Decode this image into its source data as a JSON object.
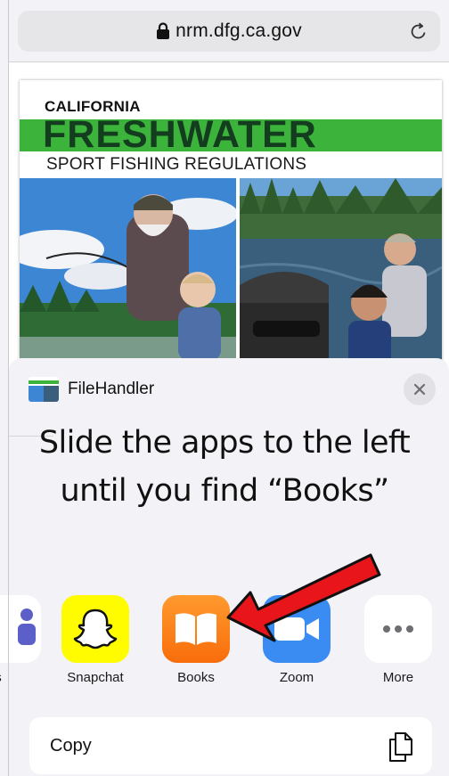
{
  "browser": {
    "url": "nrm.dfg.ca.gov",
    "lock_icon": "lock-icon",
    "reload_icon": "reload-icon"
  },
  "document": {
    "kicker": "CALIFORNIA",
    "title": "FRESHWATER",
    "subtitle": "SPORT FISHING REGULATIONS",
    "accent_color": "#3cb43c"
  },
  "share_sheet": {
    "file_name": "FileHandler",
    "close_icon": "close-icon",
    "apps": [
      {
        "label": "s",
        "icon": "teams-icon"
      },
      {
        "label": "Snapchat",
        "icon": "snapchat-icon"
      },
      {
        "label": "Books",
        "icon": "books-icon"
      },
      {
        "label": "Zoom",
        "icon": "zoom-icon"
      },
      {
        "label": "More",
        "icon": "more-icon"
      }
    ],
    "actions": [
      {
        "label": "Copy",
        "icon": "copy-icon"
      }
    ]
  },
  "annotation": {
    "line1": "Slide the apps to the left",
    "line2": "until you find “Books”",
    "arrow_color": "#e8161b"
  }
}
